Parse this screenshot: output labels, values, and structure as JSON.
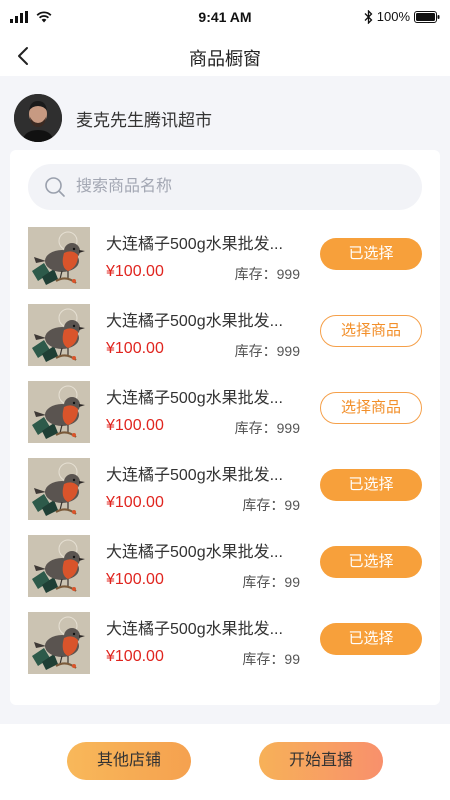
{
  "status_bar": {
    "time": "9:41 AM",
    "battery": "100%"
  },
  "nav": {
    "title": "商品橱窗",
    "back_icon": "chevron-left-icon"
  },
  "shop": {
    "name": "麦克先生腾讯超市"
  },
  "search": {
    "placeholder": "搜索商品名称"
  },
  "colors": {
    "accent": "#f7a03b",
    "price": "#e0251f"
  },
  "products": [
    {
      "title": "大连橘子500g水果批发...",
      "price": "¥100.00",
      "stock": "库存：999",
      "button": "已选择",
      "selected": true
    },
    {
      "title": "大连橘子500g水果批发...",
      "price": "¥100.00",
      "stock": "库存：999",
      "button": "选择商品",
      "selected": false
    },
    {
      "title": "大连橘子500g水果批发...",
      "price": "¥100.00",
      "stock": "库存：999",
      "button": "选择商品",
      "selected": false
    },
    {
      "title": "大连橘子500g水果批发...",
      "price": "¥100.00",
      "stock": "库存：99",
      "button": "已选择",
      "selected": true
    },
    {
      "title": "大连橘子500g水果批发...",
      "price": "¥100.00",
      "stock": "库存：99",
      "button": "已选择",
      "selected": true
    },
    {
      "title": "大连橘子500g水果批发...",
      "price": "¥100.00",
      "stock": "库存：99",
      "button": "已选择",
      "selected": true
    }
  ],
  "footer": {
    "other_shops": "其他店铺",
    "start_live": "开始直播"
  }
}
